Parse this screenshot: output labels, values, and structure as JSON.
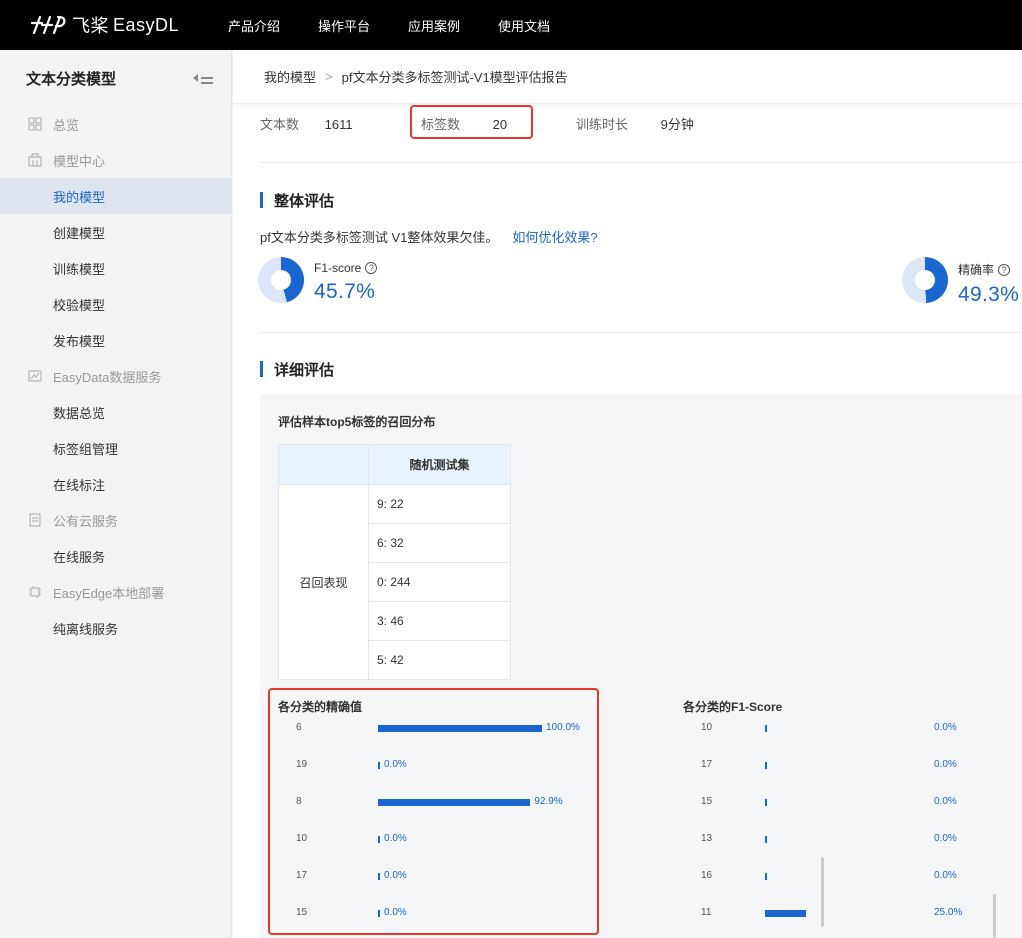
{
  "topnav": {
    "logo_mark": "飞桨",
    "logo_text": "EasyDL",
    "links": [
      "产品介绍",
      "操作平台",
      "应用案例",
      "使用文档"
    ]
  },
  "sidebar": {
    "title": "文本分类模型",
    "items": [
      {
        "label": "总览",
        "type": "group",
        "icon": "grid-icon"
      },
      {
        "label": "模型中心",
        "type": "group",
        "icon": "building-icon"
      },
      {
        "label": "我的模型",
        "type": "item",
        "active": true
      },
      {
        "label": "创建模型",
        "type": "item"
      },
      {
        "label": "训练模型",
        "type": "item"
      },
      {
        "label": "校验模型",
        "type": "item"
      },
      {
        "label": "发布模型",
        "type": "item"
      },
      {
        "label": "EasyData数据服务",
        "type": "group",
        "icon": "chart-icon"
      },
      {
        "label": "数据总览",
        "type": "item"
      },
      {
        "label": "标签组管理",
        "type": "item"
      },
      {
        "label": "在线标注",
        "type": "item"
      },
      {
        "label": "公有云服务",
        "type": "group",
        "icon": "cloud-icon"
      },
      {
        "label": "在线服务",
        "type": "item"
      },
      {
        "label": "EasyEdge本地部署",
        "type": "group",
        "icon": "chip-icon"
      },
      {
        "label": "纯离线服务",
        "type": "item"
      }
    ]
  },
  "breadcrumb": {
    "root": "我的模型",
    "separator": ">",
    "current": "pf文本分类多标签测试-V1模型评估报告"
  },
  "stats": {
    "text_count_label": "文本数",
    "text_count_value": "1611",
    "label_count_label": "标签数",
    "label_count_value": "20",
    "train_time_label": "训练时长",
    "train_time_value": "9分钟"
  },
  "overall": {
    "title": "整体评估",
    "desc": "pf文本分类多标签测试 V1整体效果欠佳。",
    "link": "如何优化效果?",
    "f1_label": "F1-score",
    "f1_value": "45.7%",
    "f1_fraction": 0.457,
    "precision_label": "精确率",
    "precision_value": "49.3%",
    "precision_fraction": 0.493,
    "help_symbol": "?"
  },
  "detail": {
    "title": "详细评估",
    "recall_title": "评估样本top5标签的召回分布",
    "recall_table": {
      "column_header": "随机测试集",
      "row_header": "召回表现",
      "values": [
        "9: 22",
        "6: 32",
        "0: 244",
        "3: 46",
        "5: 42"
      ]
    }
  },
  "chart_data": [
    {
      "type": "bar",
      "title": "各分类的精确值",
      "categories": [
        "6",
        "19",
        "8",
        "10",
        "17",
        "15"
      ],
      "values": [
        100.0,
        0.0,
        92.9,
        0.0,
        0.0,
        0.0
      ],
      "labels": [
        "100.0%",
        "0.0%",
        "92.9%",
        "0.0%",
        "0.0%",
        "0.0%"
      ],
      "ylim": [
        0,
        100
      ]
    },
    {
      "type": "bar",
      "title": "各分类的F1-Score",
      "categories": [
        "10",
        "17",
        "15",
        "13",
        "16",
        "11"
      ],
      "values": [
        0.0,
        0.0,
        0.0,
        0.0,
        0.0,
        25.0
      ],
      "labels": [
        "0.0%",
        "0.0%",
        "0.0%",
        "0.0%",
        "0.0%",
        "25.0%"
      ],
      "ylim": [
        0,
        100
      ]
    }
  ],
  "colors": {
    "accent": "#1a66d0",
    "highlight_box": "#e8372f",
    "donut_track": "#dce6f6"
  }
}
